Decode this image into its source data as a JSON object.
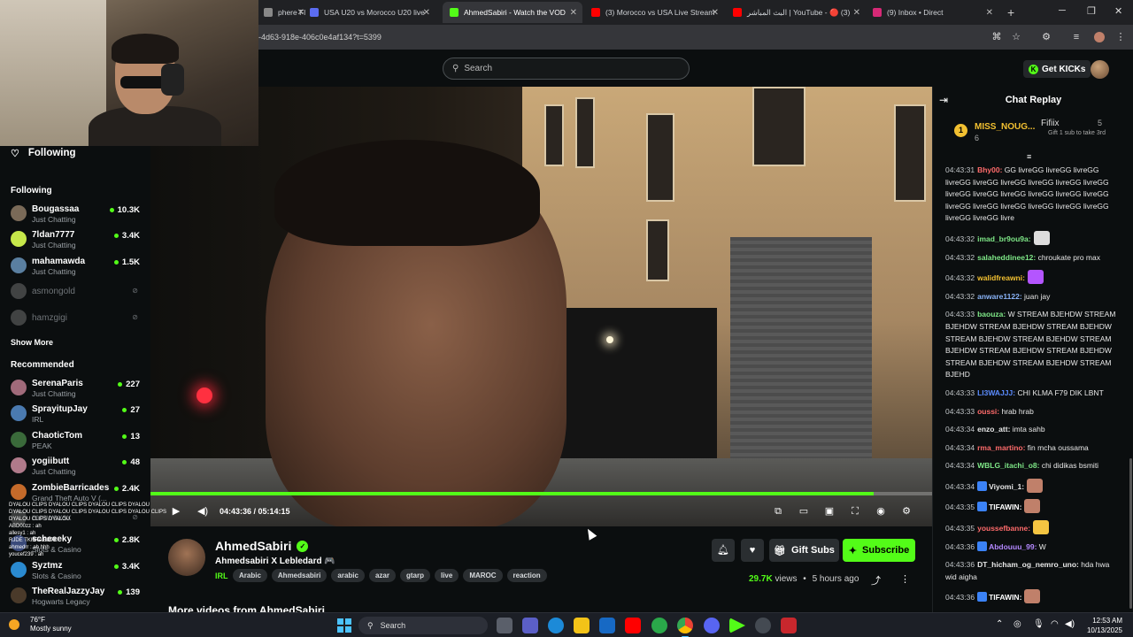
{
  "browser": {
    "tabs": [
      {
        "label": "phere Fl",
        "color": "#888888",
        "active": false
      },
      {
        "label": "USA U20 vs Morocco U20 live",
        "color": "#5b6cf0",
        "active": false
      },
      {
        "label": "AhmedSabiri - Watch the VOD",
        "color": "#53fc18",
        "active": true
      },
      {
        "label": "(3) Morocco vs USA Live Stream",
        "color": "#ff0000",
        "active": false
      },
      {
        "label": "البث المباشر | YouTube - 🔴 (3)",
        "color": "#ff0000",
        "active": false
      },
      {
        "label": "(9) Inbox • Direct",
        "color": "#d62976",
        "active": false
      }
    ],
    "url": "-4d63-918e-406c0e4af134?t=5399"
  },
  "header": {
    "search_placeholder": "Search",
    "get_kicks": "Get KICKs"
  },
  "sidebar": {
    "following_title": "Following",
    "following_label": "Following",
    "following": [
      {
        "name": "Bougassaa",
        "category": "Just Chatting",
        "viewers": "10.3K",
        "color": "#7a6a58"
      },
      {
        "name": "7ldan7777",
        "category": "Just Chatting",
        "viewers": "3.4K",
        "color": "#c6e84a"
      },
      {
        "name": "mahamawda",
        "category": "Just Chatting",
        "viewers": "1.5K",
        "color": "#5a7fa0"
      },
      {
        "name": "asmongold",
        "category": "",
        "viewers": "",
        "color": "#777777"
      },
      {
        "name": "hamzgigi",
        "category": "",
        "viewers": "",
        "color": "#777777"
      }
    ],
    "show_more": "Show More",
    "recommended_label": "Recommended",
    "recommended": [
      {
        "name": "SerenaParis",
        "category": "Just Chatting",
        "viewers": "227",
        "color": "#a06a7a"
      },
      {
        "name": "SprayitupJay",
        "category": "IRL",
        "viewers": "27",
        "color": "#4a7ab0"
      },
      {
        "name": "ChaoticTom",
        "category": "PEAK",
        "viewers": "13",
        "color": "#3a6a3a"
      },
      {
        "name": "yogiibutt",
        "category": "Just Chatting",
        "viewers": "48",
        "color": "#b07a8a"
      },
      {
        "name": "ZombieBarricades",
        "category": "Grand Theft Auto V (...",
        "viewers": "2.4K",
        "color": "#c46a2a"
      },
      {
        "name": "mrswaxsx",
        "category": "",
        "viewers": "",
        "color": "#6a6a6a"
      },
      {
        "name": "scheeeky",
        "category": "Slots & Casino",
        "viewers": "2.8K",
        "color": "#3a4a7a"
      },
      {
        "name": "Syztmz",
        "category": "Slots & Casino",
        "viewers": "3.4K",
        "color": "#2a8ad0"
      },
      {
        "name": "TheRealJazzyJay",
        "category": "Hogwarts Legacy",
        "viewers": "139",
        "color": "#4a3a2a"
      }
    ]
  },
  "clip_overlay": [
    "DYALOU CLIPS DYALOU CLIPS DYALOU CLIPS DYALOU",
    "DYALOU CLIPS DYALOU CLIPS DYALOU CLIPS DYALOU CLIPS",
    "DYALOU CLIPS DYALOU",
    "ABD00zz : ah",
    "allesy1 : ah",
    "RJDE TKHRA BD7K",
    "ahmedrr : ah hhh",
    "youcef239 : ah"
  ],
  "player": {
    "time": "04:43:36 / 05:14:15",
    "progress": 0.925
  },
  "stream": {
    "channel": "AhmedSabiri",
    "title": "Ahmedsabiri X Lebledard 🎮",
    "category": "IRL",
    "tags": [
      "Arabic",
      "Ahmedsabiri",
      "arabic",
      "azar",
      "gtarp",
      "live",
      "MAROC",
      "reaction"
    ],
    "gift_subs": "Gift Subs",
    "subscribe": "Subscribe",
    "views_count": "29.7K",
    "views_word": "views",
    "ago": "5 hours ago",
    "more_videos": "More videos from AhmedSabiri"
  },
  "chat": {
    "title": "Chat Replay",
    "pinned_user": "MISS_NOUG...",
    "pinned_rank": "1",
    "pinned_count": "6",
    "pinned2_user": "Fifiix",
    "pinned2_count": "5",
    "pinned2_sub": "Gift 1 sub to take 3rd",
    "messages": [
      {
        "ts": "04:43:31",
        "user": "Bhy00:",
        "color": "#ff6b6b",
        "text": "GG livreGG livreGG livreGG livreGG livreGG livreGG livreGG livreGG livreGG livreGG livreGG livreGG livreGG livreGG livreGG livreGG livreGG livreGG livreGG livreGG livreGG livreGG livreGG livre",
        "badge": false,
        "emote": ""
      },
      {
        "ts": "04:43:32",
        "user": "imad_br9ou9a:",
        "color": "#7ee787",
        "text": "",
        "badge": false,
        "emote": "#dddddd"
      },
      {
        "ts": "04:43:32",
        "user": "salaheddinee12:",
        "color": "#7ee787",
        "text": "chroukate pro max",
        "badge": false,
        "emote": ""
      },
      {
        "ts": "04:43:32",
        "user": "walidfreawni:",
        "color": "#f2c031",
        "text": "",
        "badge": false,
        "emote": "#b455ff"
      },
      {
        "ts": "04:43:32",
        "user": "anware1122:",
        "color": "#8ab4f8",
        "text": "juan jay",
        "badge": false,
        "emote": ""
      },
      {
        "ts": "04:43:33",
        "user": "baouza:",
        "color": "#7ee787",
        "text": "W STREAM BJEHDW STREAM BJEHDW STREAM BJEHDW STREAM BJEHDW STREAM BJEHDW STREAM BJEHDW STREAM BJEHDW STREAM BJEHDW STREAM BJEHDW STREAM BJEHDW STREAM BJEHDW STREAM BJEHD",
        "badge": false,
        "emote": ""
      },
      {
        "ts": "04:43:33",
        "user": "LI3WAJJJ:",
        "color": "#5b8cff",
        "text": "CHI KLMA F79 DIK LBNT",
        "badge": false,
        "emote": ""
      },
      {
        "ts": "04:43:33",
        "user": "oussi:",
        "color": "#ff6b6b",
        "text": "hrab hrab",
        "badge": false,
        "emote": ""
      },
      {
        "ts": "04:43:34",
        "user": "enzo_att:",
        "color": "#e8e8e8",
        "text": "imta sahb",
        "badge": false,
        "emote": ""
      },
      {
        "ts": "04:43:34",
        "user": "rma_martino:",
        "color": "#ff6b6b",
        "text": "fin mcha oussama",
        "badge": false,
        "emote": ""
      },
      {
        "ts": "04:43:34",
        "user": "WBLG_itachi_o8:",
        "color": "#7ee787",
        "text": "chi didikas bsmiti",
        "badge": false,
        "emote": ""
      },
      {
        "ts": "04:43:34",
        "user": "Viyomi_1:",
        "color": "#e8e8e8",
        "text": "",
        "badge": true,
        "emote": "#c0806a"
      },
      {
        "ts": "04:43:35",
        "user": "TIFAWIN:",
        "color": "#ffffff",
        "text": "",
        "badge": true,
        "emote": "#c0806a"
      },
      {
        "ts": "04:43:35",
        "user": "youssefbanne:",
        "color": "#ff6b6b",
        "text": "",
        "badge": false,
        "emote": "#f5c542"
      },
      {
        "ts": "04:43:36",
        "user": "Abdouuu_99:",
        "color": "#b388ff",
        "text": "W",
        "badge": true,
        "emote": ""
      },
      {
        "ts": "04:43:36",
        "user": "DT_hicham_og_nemro_uno:",
        "color": "#e8e8e8",
        "text": "hda hwa wid aigha",
        "badge": false,
        "emote": ""
      },
      {
        "ts": "04:43:36",
        "user": "TIFAWIN:",
        "color": "#ffffff",
        "text": "",
        "badge": true,
        "emote": "#c0806a"
      }
    ]
  },
  "taskbar": {
    "temp": "76°F",
    "weather": "Mostly sunny",
    "search": "Search",
    "time": "12:53 AM",
    "date": "10/13/2025"
  },
  "colors": {
    "accent": "#53fc18",
    "bg": "#0b0e0f"
  }
}
